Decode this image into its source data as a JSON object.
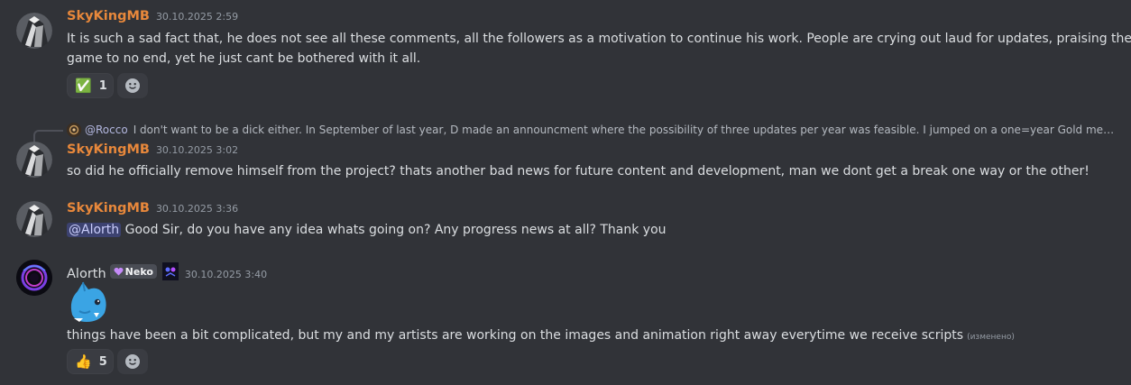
{
  "messages": [
    {
      "author": "SkyKingMB",
      "timestamp": "30.10.2025 2:59",
      "lines": [
        "It is such a sad fact that, he does not see all these comments, all the followers as a motivation to continue his work. People are crying out laud for updates, praising the",
        "game to no end, yet he just cant be bothered with it all."
      ],
      "reaction": {
        "emoji": "✅",
        "count": "1"
      }
    },
    {
      "reply": {
        "mention": "@Rocco",
        "text": "I don't want to be a dick either.  In September of last year, D made an announcment where the possibility of three updates per year was feasible.  I jumped on a one=year Gold members..."
      },
      "author": "SkyKingMB",
      "timestamp": "30.10.2025 3:02",
      "text": "so did he officially remove himself from the project? thats another bad news for future content and development, man we dont get a break one way or the other!"
    },
    {
      "author": "SkyKingMB",
      "timestamp": "30.10.2025 3:36",
      "mention": "@Alorth",
      "text": " Good Sir, do you have any idea whats going on? Any progress news at all? Thank you"
    },
    {
      "author": "Alorth",
      "role_tag": "Neko",
      "timestamp": "30.10.2025 3:40",
      "text": "things have been a bit complicated, but my and my artists are working on the images and animation right away everytime we receive scripts",
      "edited": "(изменено)",
      "reaction": {
        "emoji": "👍",
        "count": "5"
      }
    }
  ],
  "colors": {
    "background": "#313338",
    "author_name": "#e8883b",
    "mention_bg": "#3c4270",
    "mention_text": "#c9cdfb"
  },
  "icons": {
    "add_reaction": "smiley-face-icon",
    "sticker": "blue-creature-sticker"
  }
}
